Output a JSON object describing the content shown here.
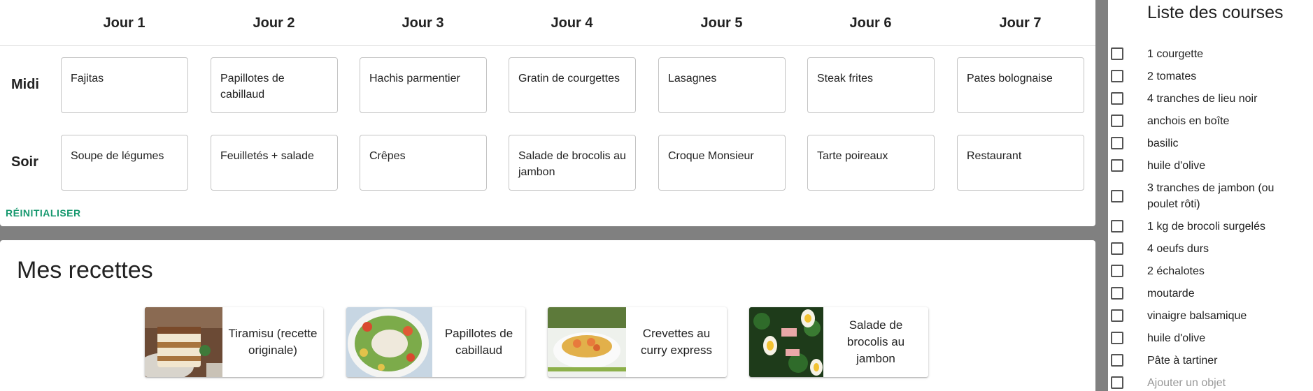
{
  "planner": {
    "days": [
      "Jour 1",
      "Jour 2",
      "Jour 3",
      "Jour 4",
      "Jour 5",
      "Jour 6",
      "Jour 7"
    ],
    "meals": [
      {
        "label": "Midi",
        "dishes": [
          "Fajitas",
          "Papillotes de cabillaud",
          "Hachis parmentier",
          "Gratin de courgettes",
          "Lasagnes",
          "Steak frites",
          "Pates bolognaise"
        ]
      },
      {
        "label": "Soir",
        "dishes": [
          "Soupe de légumes",
          "Feuilletés + salade",
          "Crêpes",
          "Salade de brocolis au jambon",
          "Croque Monsieur",
          "Tarte poireaux",
          "Restaurant"
        ]
      }
    ],
    "reset_label": "RÉINITIALISER"
  },
  "recipes": {
    "title": "Mes recettes",
    "items": [
      {
        "name": "Tiramisu (recette originale)",
        "image": "tiramisu-photo"
      },
      {
        "name": "Papillotes de cabillaud",
        "image": "cod-salad-photo"
      },
      {
        "name": "Crevettes au curry express",
        "image": "shrimp-curry-photo"
      },
      {
        "name": "Salade de brocolis au jambon",
        "image": "broccoli-salad-photo"
      }
    ]
  },
  "shopping": {
    "title": "Liste des courses",
    "items": [
      "1 courgette",
      "2 tomates",
      "4 tranches de lieu noir",
      "anchois en boîte",
      "basilic",
      "huile d'olive",
      "3 tranches de jambon (ou poulet rôti)",
      "1 kg de brocoli surgelés",
      "4 oeufs durs",
      "2 échalotes",
      "moutarde",
      "vinaigre balsamique",
      "huile d'olive",
      "Pâte à tartiner"
    ],
    "add_placeholder": "Ajouter un objet"
  },
  "colors": {
    "accent": "#16986e",
    "background": "#808080"
  }
}
